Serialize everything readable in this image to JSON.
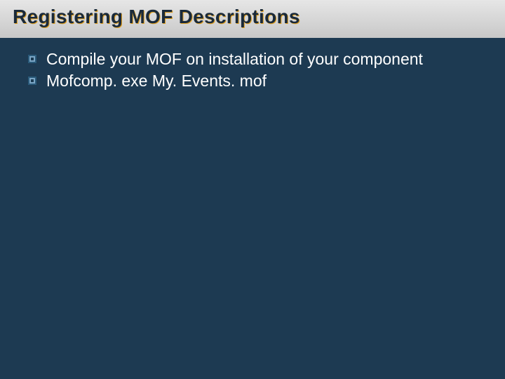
{
  "slide": {
    "title": "Registering MOF Descriptions",
    "bullets": [
      {
        "text": "Compile your MOF on installation of your component"
      },
      {
        "text": "Mofcomp. exe My. Events. mof"
      }
    ]
  }
}
